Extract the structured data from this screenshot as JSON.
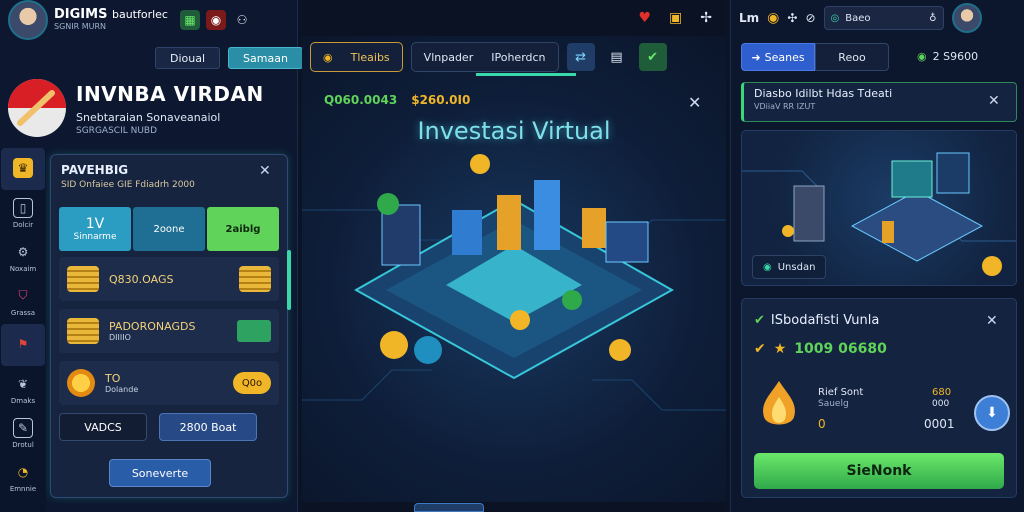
{
  "left": {
    "brand": "DIGIMS",
    "brand_tail": "bautforlec",
    "brand_sub": "SGNIR MURN",
    "header_buttons": [
      "Dioual",
      "Samaan"
    ],
    "hero_title": "INVNBA VIRDAN",
    "hero_sub1": "Snebtaraian Sonaveanaiol",
    "hero_sub2": "SGRGASCIL NUBD",
    "nav": [
      {
        "label": "",
        "icon": "trophy-icon"
      },
      {
        "label": "Dolcir",
        "icon": "phone-icon"
      },
      {
        "label": "Noxaim",
        "icon": "gear-icon"
      },
      {
        "label": "Grassa",
        "icon": "shield-icon"
      },
      {
        "label": "",
        "icon": "flag-icon"
      },
      {
        "label": "Dmaks",
        "icon": "leaf-icon"
      },
      {
        "label": "Drotul",
        "icon": "edit-icon"
      },
      {
        "label": "Emnnie",
        "icon": "notification-icon"
      }
    ],
    "card": {
      "title": "PAVEHBIG",
      "desc": "SID Onfaiee GIE Fdiadrh 2000",
      "seg": [
        {
          "top": "1V",
          "bottom": "Sinnarme"
        },
        {
          "top": "2oone",
          "bottom": ""
        },
        {
          "top": "2aiblg",
          "bottom": ""
        }
      ],
      "rows": [
        {
          "text": "Q830.OAGS",
          "sub": "",
          "right": ""
        },
        {
          "text": "PADORONAGDS",
          "sub": "DIIIIO",
          "right": ""
        },
        {
          "text": "TO",
          "sub": "Dolande",
          "right": "Q0o"
        }
      ],
      "btn_left": "VADCS",
      "btn_right": "2800 Boat",
      "footer_btn": "Soneverte"
    }
  },
  "center": {
    "tabs": [
      "Tleaibs",
      "Vlnpader",
      "IPoherdcn"
    ],
    "price_a": "Q060.0043",
    "price_b": "$260.0I0",
    "title": "Investasi Virtual"
  },
  "right": {
    "app_label": "Lm",
    "search_text": "Baeo",
    "tabs": [
      "Seanes",
      "Reoo"
    ],
    "balance": "2 S9600",
    "notice_title": "Diasbo Idilbt Hdas Tdeati",
    "notice_sub": "VDiiaV RR IZUT",
    "visual_label": "Unsdan",
    "detail_title": "ISbodafisti Vunla",
    "detail_amount": "1009 06680",
    "detail_left_top": "Rief Sont",
    "detail_left_mid": "Sauelg",
    "detail_left_bottom": "0",
    "detail_right_top": "680",
    "detail_right_mid": "000",
    "detail_right_bottom": "0001",
    "cta": "SieNonk"
  },
  "colors": {
    "accent_teal": "#3ad8a9",
    "gold": "#f0b628",
    "green": "#5fd35a",
    "blue": "#2f5fcf"
  }
}
